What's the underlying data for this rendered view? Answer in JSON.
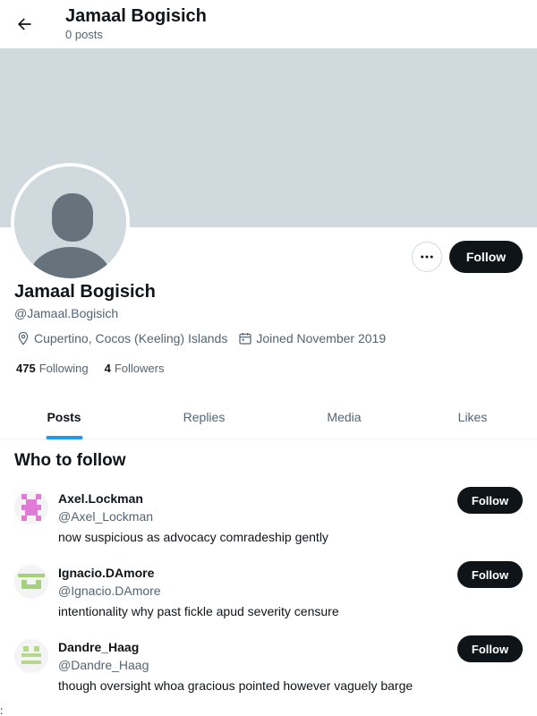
{
  "header": {
    "title": "Jamaal Bogisich",
    "subtitle": "0 posts",
    "back_icon": "arrow-left-icon"
  },
  "banner": {
    "color": "#cfd9de"
  },
  "profile": {
    "name": "Jamaal Bogisich",
    "handle": "@Jamaal.Bogisich",
    "location": "Cupertino, Cocos (Keeling) Islands",
    "joined": "Joined November 2019",
    "following_count": "475",
    "following_label": "Following",
    "followers_count": "4",
    "followers_label": "Followers",
    "more_icon": "more-horizontal-icon",
    "follow_label": "Follow"
  },
  "tabs": [
    {
      "label": "Posts",
      "active": true
    },
    {
      "label": "Replies",
      "active": false
    },
    {
      "label": "Media",
      "active": false
    },
    {
      "label": "Likes",
      "active": false
    }
  ],
  "who_to_follow": {
    "title": "Who to follow",
    "users": [
      {
        "name": "Axel.Lockman",
        "handle": "@Axel_Lockman",
        "bio": "now suspicious as advocacy comradeship gently",
        "follow_label": "Follow",
        "avatar_color": "#e07ad6"
      },
      {
        "name": "Ignacio.DAmore",
        "handle": "@Ignacio.DAmore",
        "bio": "intentionality why past fickle apud severity censure",
        "follow_label": "Follow",
        "avatar_color": "#a3d27a"
      },
      {
        "name": "Dandre_Haag",
        "handle": "@Dandre_Haag",
        "bio": "though oversight whoa gracious pointed however vaguely barge",
        "follow_label": "Follow",
        "avatar_color": "#b5d98a"
      }
    ]
  },
  "footer_mark": ":",
  "colors": {
    "accent": "#1d9bf0",
    "text_primary": "#0f1419",
    "text_secondary": "#536471",
    "button_dark": "#0f1419"
  }
}
